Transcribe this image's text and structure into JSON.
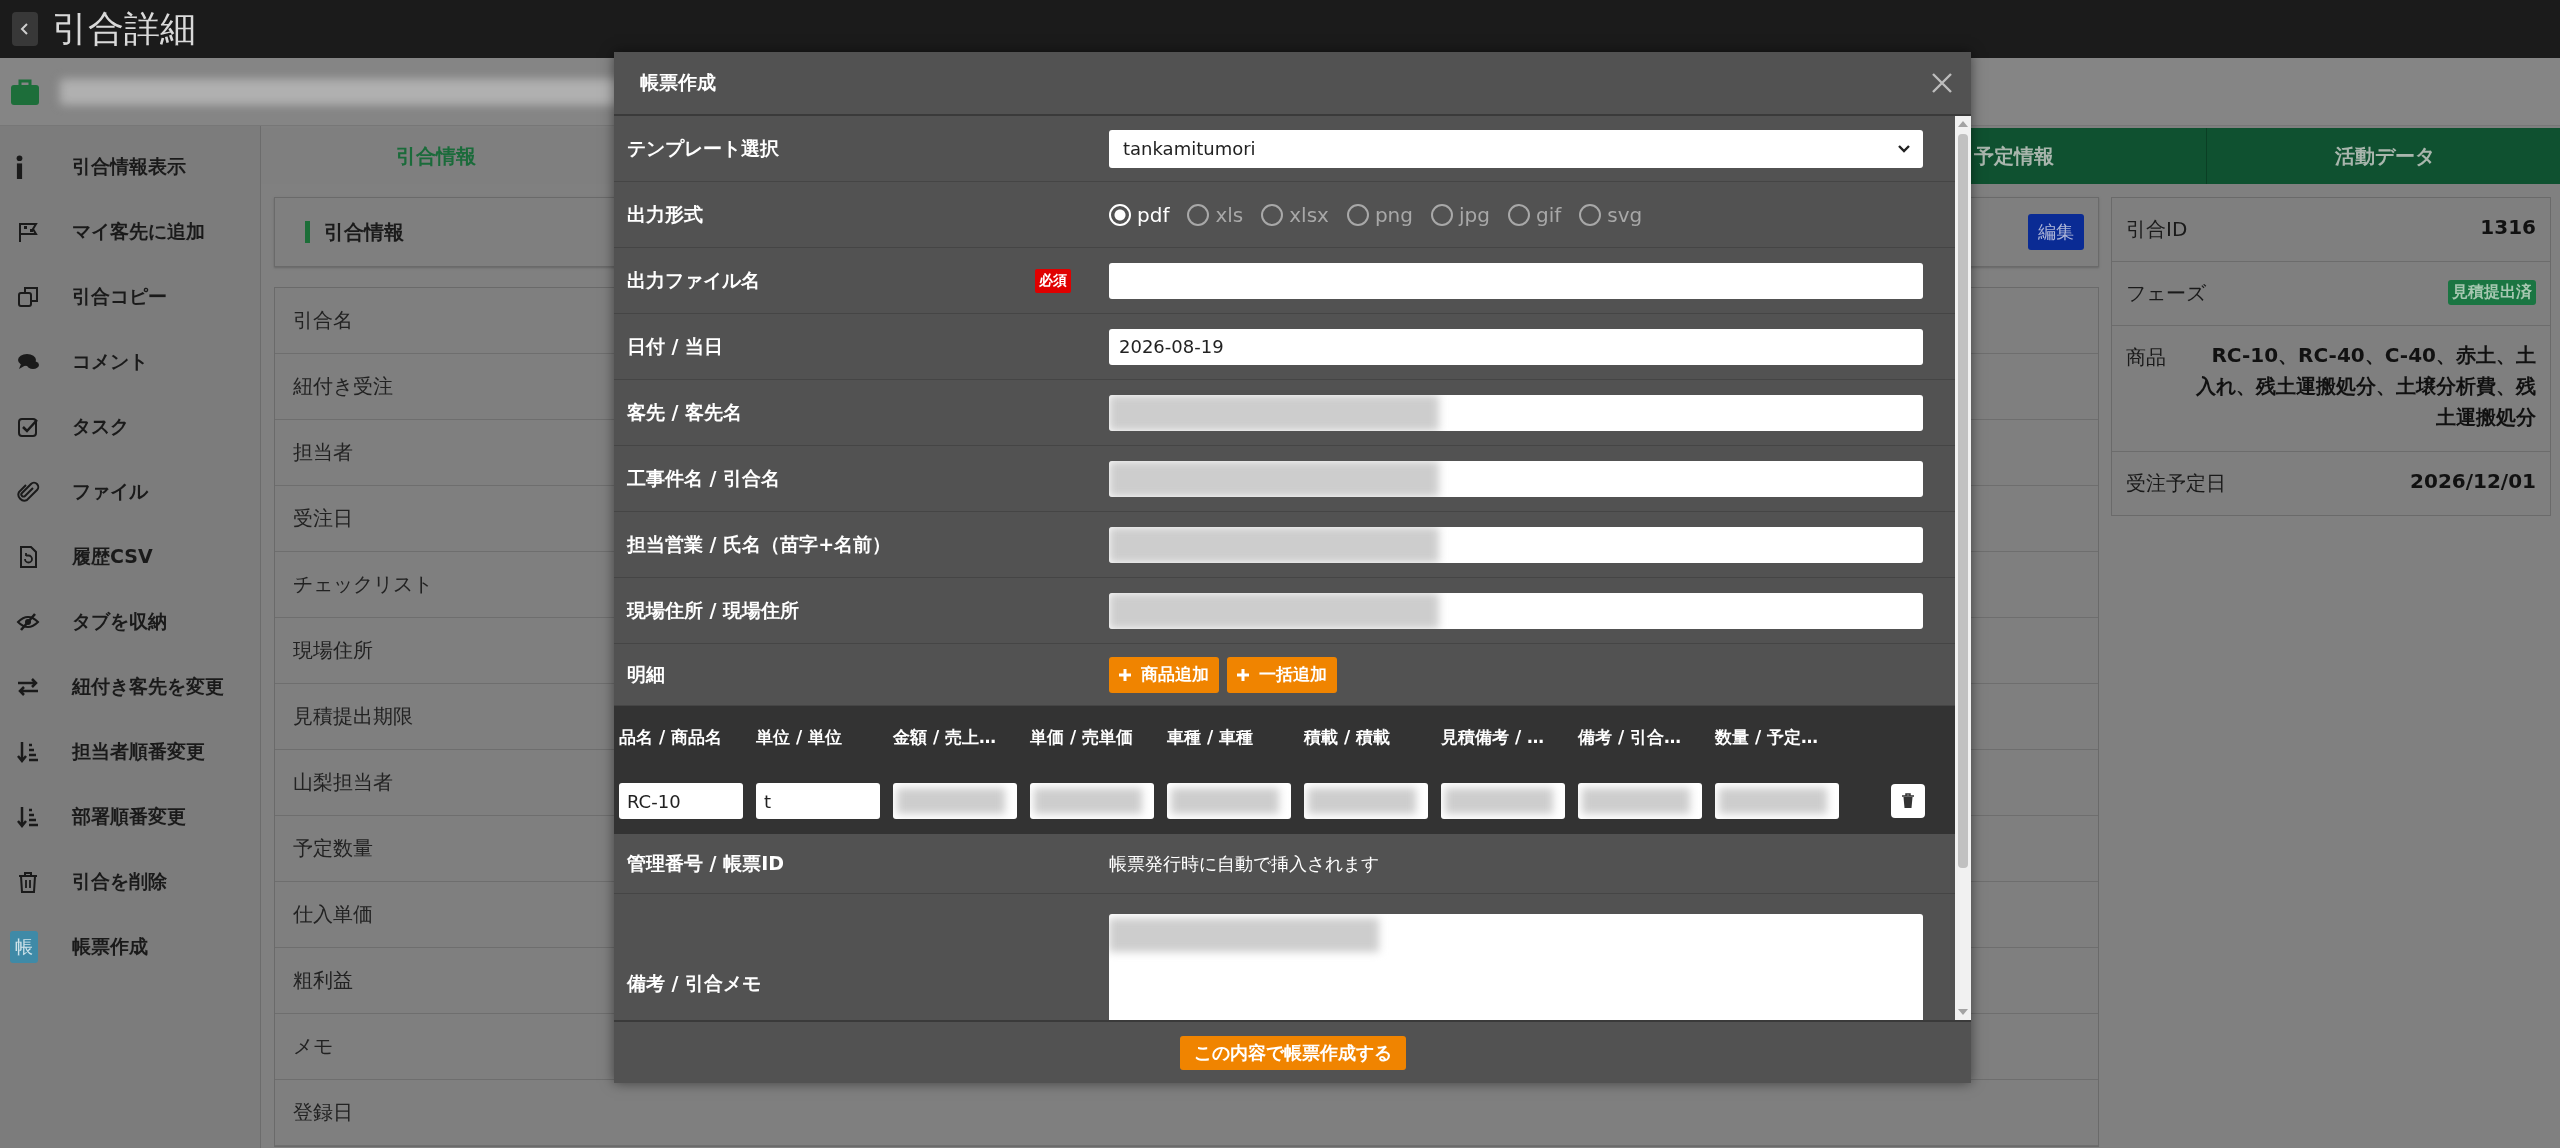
{
  "header": {
    "title": "引合詳細"
  },
  "sidebar": {
    "items": [
      {
        "label": "引合情報表示"
      },
      {
        "label": "マイ客先に追加"
      },
      {
        "label": "引合コピー"
      },
      {
        "label": "コメント"
      },
      {
        "label": "タスク"
      },
      {
        "label": "ファイル"
      },
      {
        "label": "履歴CSV"
      },
      {
        "label": "タブを収納"
      },
      {
        "label": "紐付き客先を変更"
      },
      {
        "label": "担当者順番変更"
      },
      {
        "label": "部署順番変更"
      },
      {
        "label": "引合を削除"
      },
      {
        "label": "帳票作成",
        "badge": "帳"
      }
    ]
  },
  "tabs": [
    {
      "label": "引合情報",
      "selected": true
    },
    {
      "label": "予定情報",
      "selected": false
    },
    {
      "label": "活動データ",
      "selected": false
    }
  ],
  "info_section": {
    "title": "引合情報",
    "edit_button": "編集"
  },
  "info_rows": [
    "引合名",
    "紐付き受注",
    "担当者",
    "受注日",
    "チェックリスト",
    "現場住所",
    "見積提出期限",
    "山梨担当者",
    "予定数量",
    "仕入単価",
    "粗利益",
    "メモ",
    "登録日"
  ],
  "summary": {
    "rows": [
      {
        "kind": "text",
        "label": "引合ID",
        "value": "1316"
      },
      {
        "kind": "badge",
        "label": "フェーズ",
        "value": "見積提出済"
      },
      {
        "kind": "text",
        "label": "商品",
        "value": "RC-10、RC-40、C-40、赤土、土入れ、残土運搬処分、土壌分析費、残土運搬処分"
      },
      {
        "kind": "text",
        "label": "受注予定日",
        "value": "2026/12/01"
      }
    ]
  },
  "dialog": {
    "title": "帳票作成",
    "rows": [
      {
        "kind": "select",
        "label": "テンプレート選択",
        "value": "tankamitumori"
      },
      {
        "kind": "radio",
        "label": "出力形式",
        "options": [
          {
            "label": "pdf",
            "selected": true
          },
          {
            "label": "xls",
            "selected": false
          },
          {
            "label": "xlsx",
            "selected": false
          },
          {
            "label": "png",
            "selected": false
          },
          {
            "label": "jpg",
            "selected": false
          },
          {
            "label": "gif",
            "selected": false
          },
          {
            "label": "svg",
            "selected": false
          }
        ]
      },
      {
        "kind": "input",
        "label": "出力ファイル名",
        "required_badge": "必須"
      },
      {
        "kind": "input",
        "label": "日付 / 当日",
        "value": "2026-08-19"
      },
      {
        "kind": "input",
        "label": "客先 / 客先名",
        "redacted": true
      },
      {
        "kind": "input",
        "label": "工事件名 / 引合名",
        "redacted": true
      },
      {
        "kind": "input",
        "label": "担当営業 / 氏名（苗字+名前）",
        "redacted": true
      },
      {
        "kind": "input",
        "label": "現場住所 / 現場住所",
        "redacted": true
      },
      {
        "kind": "buttons",
        "label": "明細",
        "buttons": [
          "商品追加",
          "一括追加"
        ]
      },
      {
        "kind": "table",
        "columns": [
          "品名 / 商品名",
          "単位 / 単位",
          "金額 / 売上…",
          "単価 / 売単価",
          "車種 / 車種",
          "積載 / 積載",
          "見積備考 / …",
          "備考 / 引合…",
          "数量 / 予定…"
        ],
        "rows": [
          {
            "cells": [
              {
                "value": "RC-10"
              },
              {
                "value": "t"
              },
              {
                "redacted": true
              },
              {
                "redacted": true
              },
              {
                "redacted": true
              },
              {
                "redacted": true
              },
              {
                "redacted": true
              },
              {
                "redacted": true
              },
              {
                "redacted": true
              }
            ]
          }
        ]
      },
      {
        "kind": "static",
        "label": "管理番号 / 帳票ID",
        "value": "帳票発行時に自動で挿入されます"
      },
      {
        "kind": "textarea",
        "label": "備考 / 引合メモ",
        "redacted": true
      }
    ],
    "submit_button": "この内容で帳票作成する"
  }
}
